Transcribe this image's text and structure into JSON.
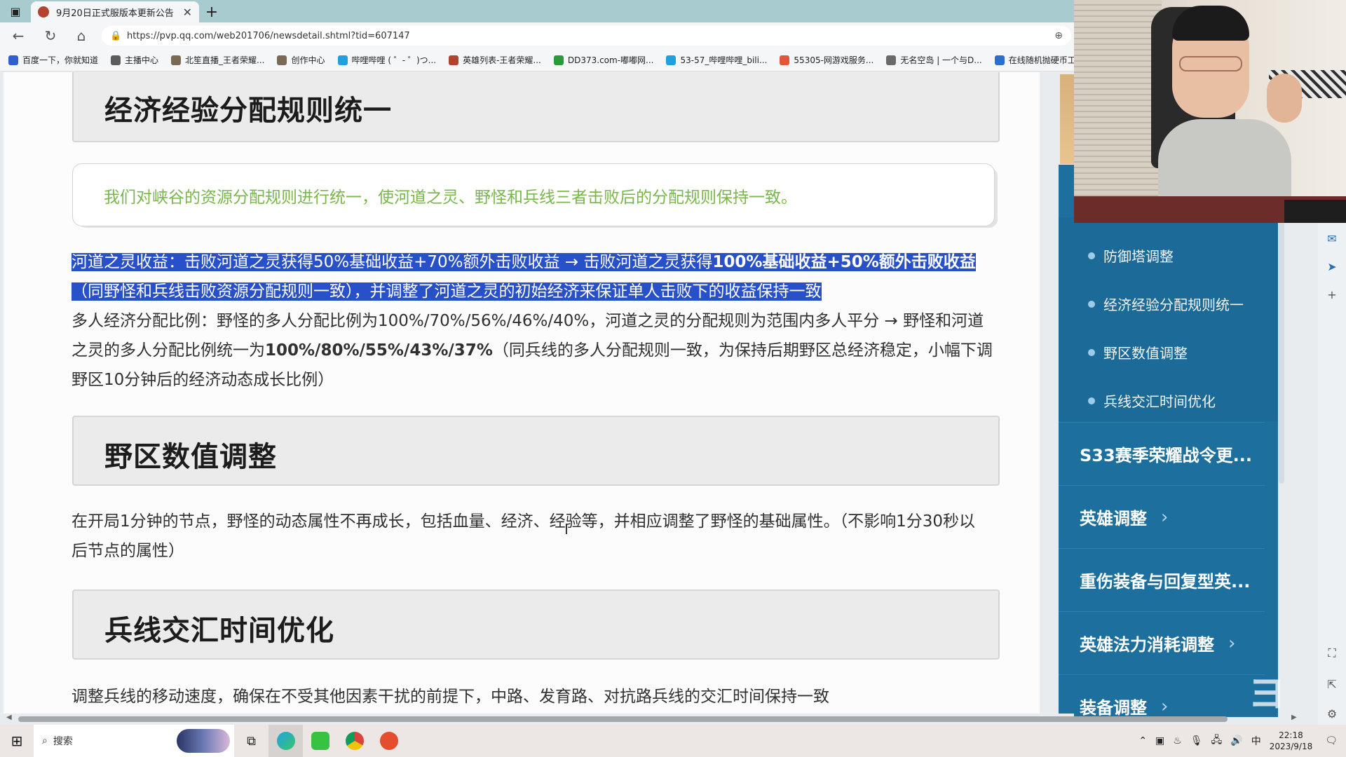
{
  "browser": {
    "tab_title": "9月20日正式服版本更新公告",
    "url": "https://pvp.qq.com/web201706/newsdetail.shtml?tid=607147",
    "bookmarks": [
      "百度一下，你就知道",
      "主播中心",
      "北笙直播_王者荣耀...",
      "创作中心",
      "哔哩哔哩 ( ゜- ゜)つ...",
      "英雄列表-王者荣耀...",
      "DD373.com-嘟嘟网...",
      "53-57_哔哩哔哩_bili...",
      "55305-网游戏服务...",
      "无名空岛 | 一个与D...",
      "在线随机抛硬币工..."
    ]
  },
  "article": {
    "section1_title": "经济经验分配规则统一",
    "summary": "我们对峡谷的资源分配规则进行统一，使河道之灵、野怪和兵线三者击败后的分配规则保持一致。",
    "p1_a": "河道之灵收益：击败河道之灵获得50%基础收益+70%额外击败收益 → 击败河道之灵获得",
    "p1_b": "100%基础收益+50%额外击败收益",
    "p1_c": "（同野怪和兵线击败资源分配规则一致），并调整了河道之灵的初始经济来保证单人击败下的收益保持一致",
    "p2_a": "多人经济分配比例：野怪的多人分配比例为100%/70%/56%/46%/40%，河道之灵的分配规则为范围内多人平分 → 野怪和河道",
    "p2_b": "之灵的多人分配比例统一为",
    "p2_c": "100%/80%/55%/43%/37%",
    "p2_d": "（同兵线的多人分配规则一致，为保持后期野区总经济稳定，小幅下调",
    "p2_e": "野区10分钟后的经济动态成长比例）",
    "section2_title": "野区数值调整",
    "p3_a": "在开局1分钟的节点，野怪的动态属性不再成长，包括血量、经济、经验等，并相应调整了野怪的基础属性。（不影响1分30秒以",
    "p3_b": "后节点的属性）",
    "section3_title": "兵线交汇时间优化",
    "p4": "调整兵线的移动速度，确保在不受其他因素干扰的前提下，中路、发育路、对抗路兵线的交汇时间保持一致"
  },
  "sidenav": {
    "subitems": [
      "防御塔调整",
      "经济经验分配规则统一",
      "野区数值调整",
      "兵线交汇时间优化"
    ],
    "items": [
      {
        "label": "S33赛季荣耀战令更...",
        "chevron": ""
      },
      {
        "label": "英雄调整",
        "chevron": "›"
      },
      {
        "label": "重伤装备与回复型英...",
        "chevron": ""
      },
      {
        "label": "英雄法力消耗调整",
        "chevron": "›"
      },
      {
        "label": "装备调整",
        "chevron": "›"
      }
    ]
  },
  "taskbar": {
    "search_placeholder": "搜索",
    "time": "22:18",
    "date": "2023/9/18",
    "ime": "中"
  },
  "colors": {
    "summary_green": "#79b64b",
    "highlight_blue": "#2850c8",
    "nav_blue": "#1d6f9e"
  }
}
